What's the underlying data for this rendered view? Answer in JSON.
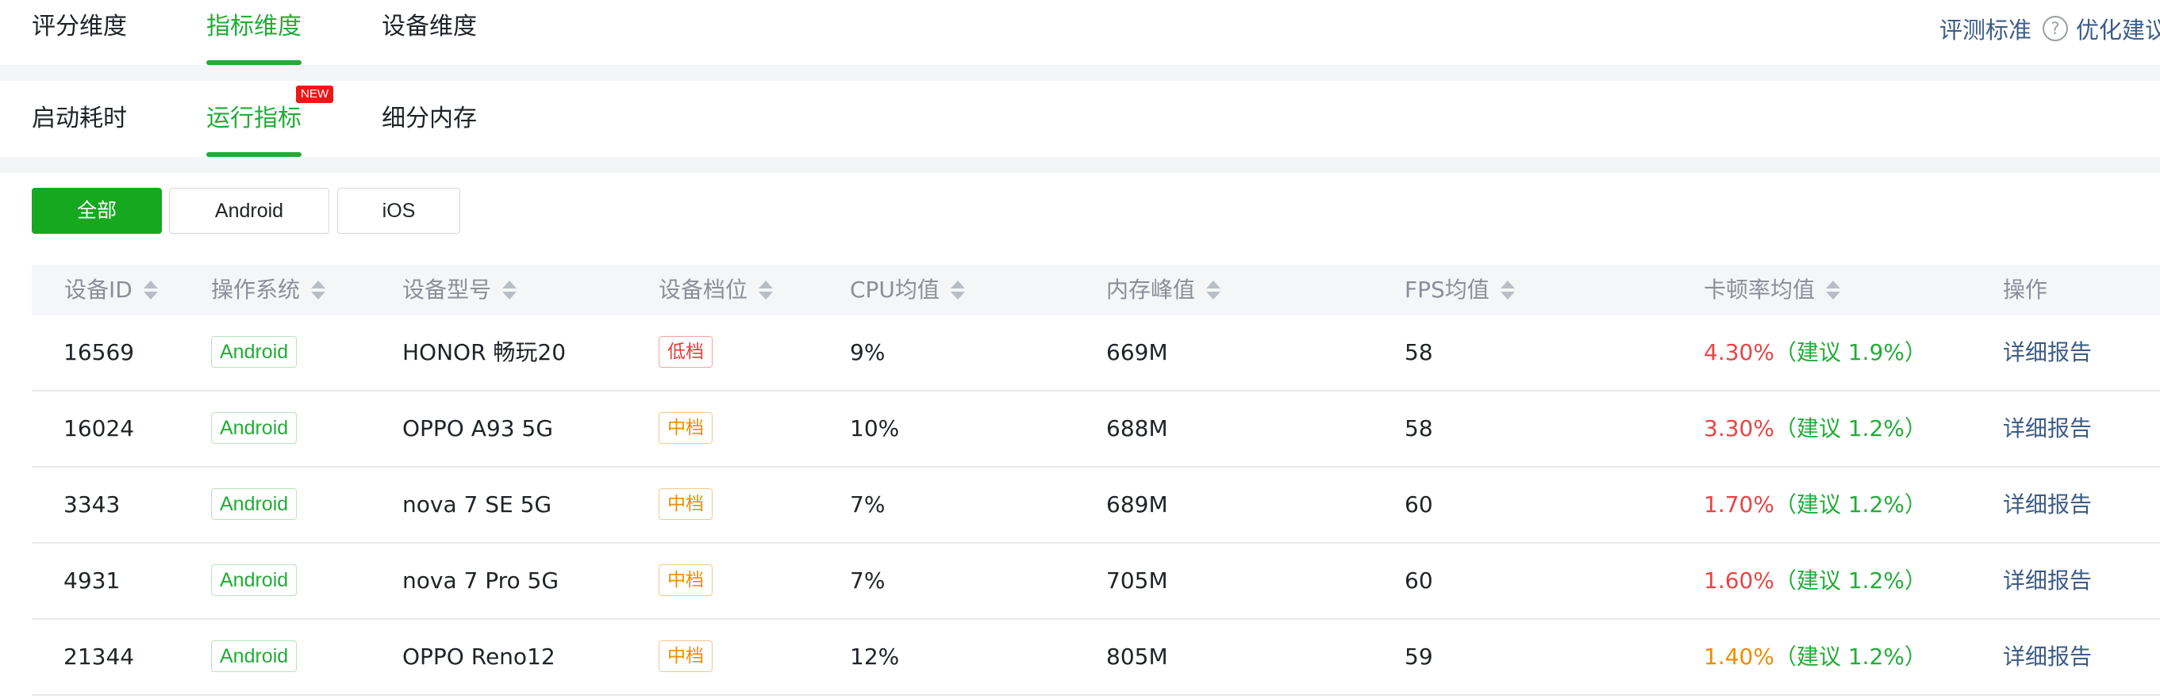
{
  "top_tabs": [
    "评分维度",
    "指标维度",
    "设备维度"
  ],
  "top_right": {
    "standard_label": "评测标准",
    "help_icon": "question-circle-icon",
    "advice_label": "优化建议"
  },
  "sub_tabs": [
    "启动耗时",
    "运行指标",
    "细分内存"
  ],
  "new_badge": "NEW",
  "filters": [
    "全部",
    "Android",
    "iOS"
  ],
  "columns": [
    "设备ID",
    "操作系统",
    "设备型号",
    "设备档位",
    "CPU均值",
    "内存峰值",
    "FPS均值",
    "卡顿率均值",
    "操作"
  ],
  "rows": [
    {
      "id": "16569",
      "os": "Android",
      "model": "HONOR 畅玩20",
      "level": "低档",
      "cpu": "9%",
      "mem": "669M",
      "fps": "58",
      "jank": "4.30%",
      "suggest": "（建议 1.9%）",
      "action": "详细报告"
    },
    {
      "id": "16024",
      "os": "Android",
      "model": "OPPO A93 5G",
      "level": "中档",
      "cpu": "10%",
      "mem": "688M",
      "fps": "58",
      "jank": "3.30%",
      "suggest": "（建议 1.2%）",
      "action": "详细报告"
    },
    {
      "id": "3343",
      "os": "Android",
      "model": "nova 7 SE 5G",
      "level": "中档",
      "cpu": "7%",
      "mem": "689M",
      "fps": "60",
      "jank": "1.70%",
      "suggest": "（建议 1.2%）",
      "action": "详细报告"
    },
    {
      "id": "4931",
      "os": "Android",
      "model": "nova 7 Pro 5G",
      "level": "中档",
      "cpu": "7%",
      "mem": "705M",
      "fps": "60",
      "jank": "1.60%",
      "suggest": "（建议 1.2%）",
      "action": "详细报告"
    },
    {
      "id": "21344",
      "os": "Android",
      "model": "OPPO Reno12",
      "level": "中档",
      "cpu": "12%",
      "mem": "805M",
      "fps": "59",
      "jank": "1.40%",
      "suggest": "（建议 1.2%）",
      "action": "详细报告"
    }
  ],
  "colors": {
    "accent_green": "#22ac38",
    "jank_red": "#e84545",
    "jank_orange": "#f08c00",
    "link_blue": "#3d5c87"
  }
}
